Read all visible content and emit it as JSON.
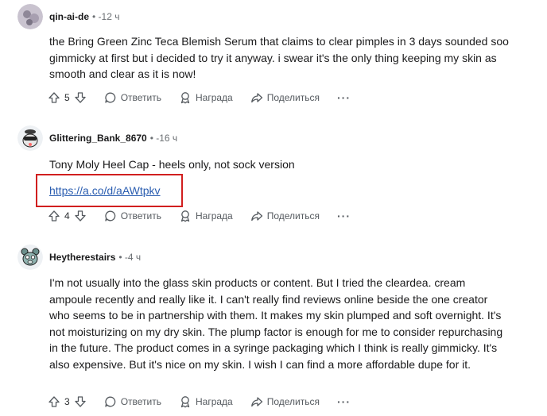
{
  "comments": [
    {
      "author": "qin-ai-de",
      "time": "• -12 ч",
      "body": "the Bring Green Zinc Teca Blemish Serum that claims to clear pimples in 3 days sounded soo gimmicky at first but i decided to try it anyway. i swear it's the only thing keeping my skin as smooth and clear as it is now!",
      "votes": "5"
    },
    {
      "author": "Glittering_Bank_8670",
      "time": "• -16 ч",
      "body": "Tony Moly Heel Cap - heels only, not sock version",
      "link": "https://a.co/d/aAWtpkv",
      "votes": "4"
    },
    {
      "author": "Heytherestairs",
      "time": "• -4 ч",
      "body": "I'm not usually into the glass skin products or content. But I tried the cleardea. cream ampoule recently and really like it. I can't really find reviews online beside the one creator who seems to be in partnership with them. It makes my skin plumped and soft overnight. It's not moisturizing on my dry skin. The plump factor is enough for me to consider repurchasing in the future. The product comes in a syringe packaging which I think is really gimmicky. It's also expensive. But it's nice on my skin. I wish I can find a more affordable dupe for it.",
      "votes": "3"
    }
  ],
  "actions": {
    "reply": "Ответить",
    "award": "Награда",
    "share": "Поделиться",
    "more": "···"
  },
  "colors": {
    "highlight_border": "#d11f1f",
    "link": "#2a5db0"
  }
}
